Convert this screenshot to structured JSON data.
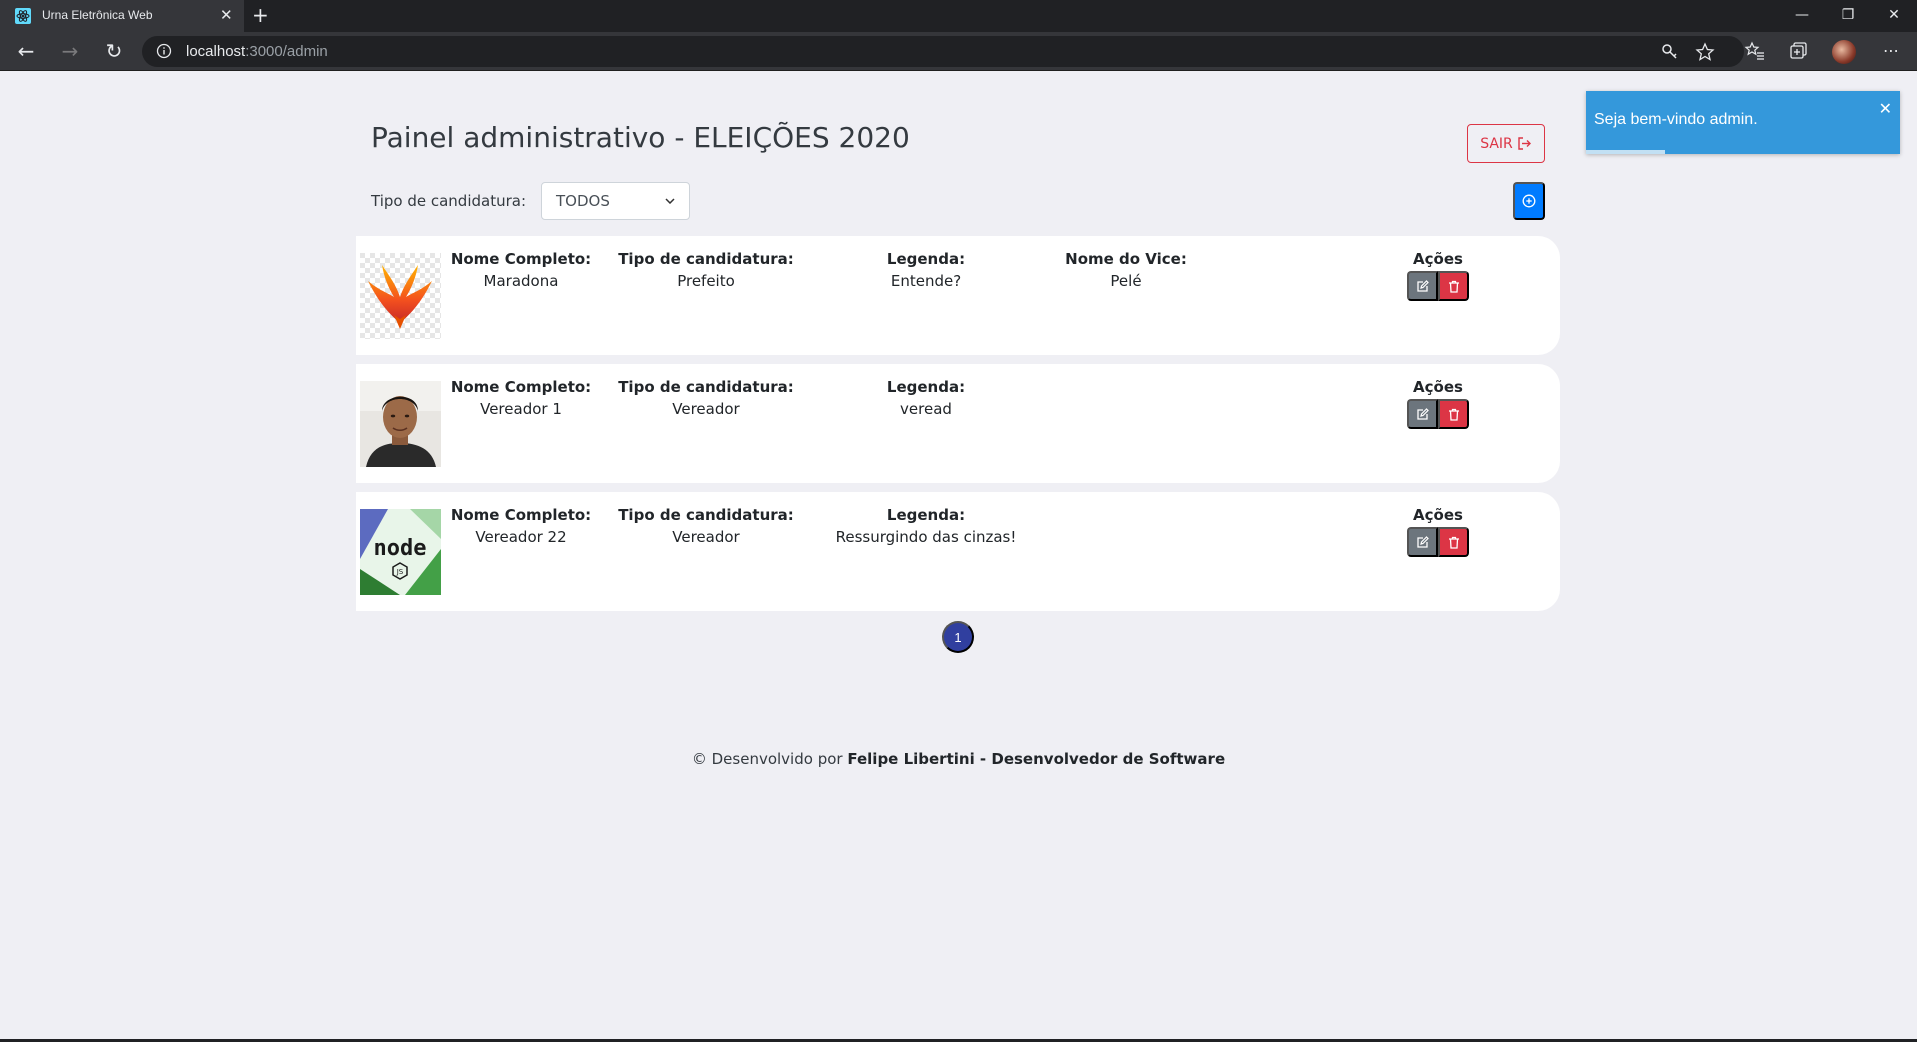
{
  "browser": {
    "tab_title": "Urna Eletrônica Web",
    "url_host": "localhost",
    "url_path": ":3000/admin",
    "tab_close": "✕",
    "new_tab": "+",
    "win_minimize": "—",
    "win_restore": "❐",
    "win_close": "✕",
    "back": "←",
    "forward": "→",
    "reload": "↻",
    "menu": "⋯"
  },
  "header": {
    "title": "Painel administrativo - ELEIÇÕES 2020",
    "logout_label": "SAIR"
  },
  "filter": {
    "label": "Tipo de candidatura:",
    "selected": "TODOS"
  },
  "columns": {
    "name": "Nome Completo:",
    "type": "Tipo de candidatura:",
    "legend": "Legenda:",
    "vice": "Nome do Vice:",
    "actions": "Ações"
  },
  "candidates": [
    {
      "name": "Maradona",
      "type": "Prefeito",
      "legend": "Entende?",
      "vice": "Pelé",
      "photo": "phoenix-logo"
    },
    {
      "name": "Vereador 1",
      "type": "Vereador",
      "legend": "veread",
      "vice": "",
      "photo": "person-photo"
    },
    {
      "name": "Vereador 22",
      "type": "Vereador",
      "legend": "Ressurgindo das cinzas!",
      "vice": "",
      "photo": "node-logo"
    }
  ],
  "pagination": {
    "current_page": "1"
  },
  "footer": {
    "prefix": "© Desenvolvido por",
    "author": "Felipe Libertini - Desenvolvedor de Software"
  },
  "toast": {
    "message": "Seja bem-vindo admin.",
    "close": "✕",
    "progress": 0.25
  },
  "colors": {
    "accent": "#007bff",
    "danger": "#dc3545",
    "secondary": "#6c757d",
    "toast": "#3498db",
    "pagination": "#303f9f"
  },
  "icons": {
    "add": "plus-circle-icon",
    "edit": "edit-icon",
    "delete": "trash-icon",
    "logout": "sign-out-icon"
  }
}
